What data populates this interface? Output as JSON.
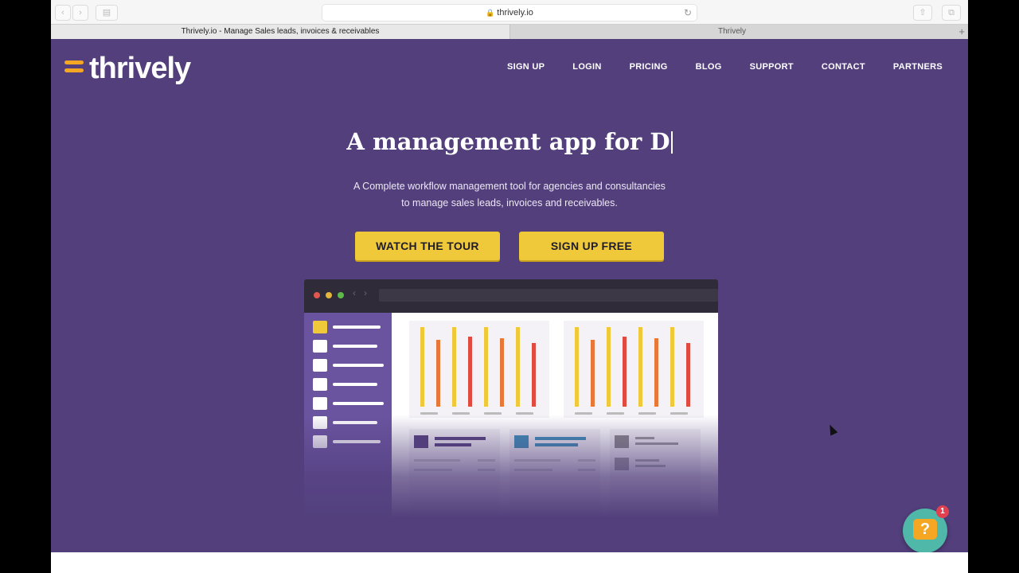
{
  "browser": {
    "address": "thrively.io",
    "tabs": [
      {
        "label": "Thrively.io - Manage Sales leads, invoices & receivables"
      },
      {
        "label": "Thrively"
      }
    ]
  },
  "header": {
    "logo_text": "thrively",
    "nav": [
      "SIGN UP",
      "LOGIN",
      "PRICING",
      "BLOG",
      "SUPPORT",
      "CONTACT",
      "PARTNERS"
    ]
  },
  "hero": {
    "headline": "A management app for D",
    "subtitle_line1": "A Complete workflow management tool for agencies and consultancies",
    "subtitle_line2": "to manage sales leads, invoices and receivables.",
    "cta_tour": "WATCH THE TOUR",
    "cta_signup": "SIGN UP FREE"
  },
  "chat_widget": {
    "icon": "?",
    "badge_count": "1"
  },
  "colors": {
    "brand_purple": "#523f7c",
    "cta_yellow": "#f0c93a",
    "logo_orange": "#f5a623",
    "chat_teal": "#4fb8a8"
  }
}
